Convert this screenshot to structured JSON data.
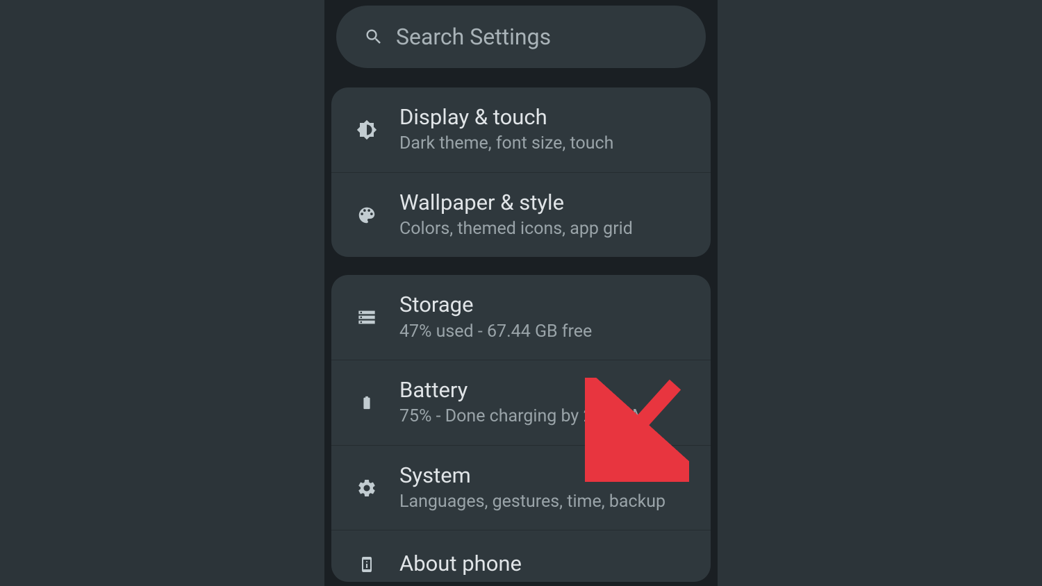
{
  "search": {
    "placeholder": "Search Settings"
  },
  "group1": {
    "items": [
      {
        "title": "Display & touch",
        "subtitle": "Dark theme, font size, touch"
      },
      {
        "title": "Wallpaper & style",
        "subtitle": "Colors, themed icons, app grid"
      }
    ]
  },
  "group2": {
    "items": [
      {
        "title": "Storage",
        "subtitle": "47% used - 67.44 GB free"
      },
      {
        "title": "Battery",
        "subtitle": "75% - Done charging by 2:12 AM"
      },
      {
        "title": "System",
        "subtitle": "Languages, gestures, time, backup"
      },
      {
        "title": "About phone",
        "subtitle": ""
      }
    ]
  }
}
